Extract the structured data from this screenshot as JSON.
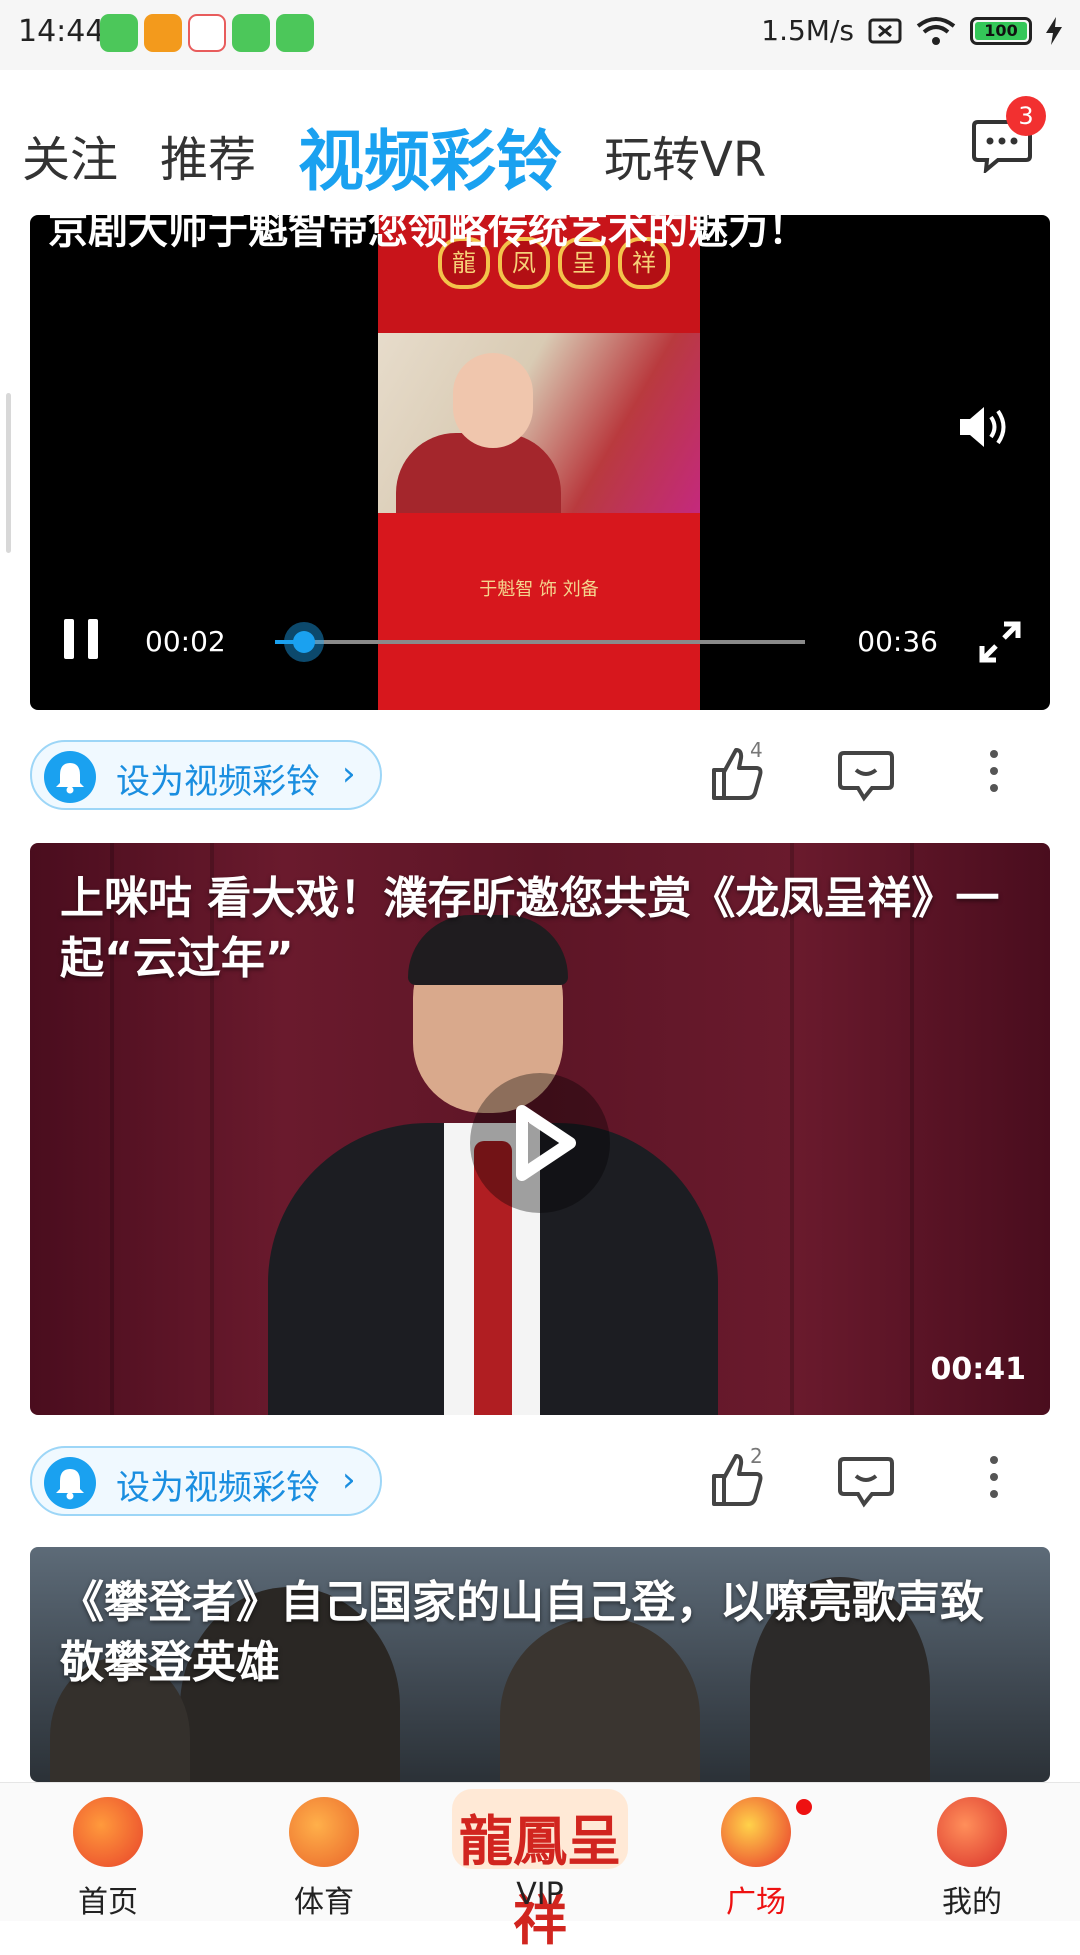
{
  "status_bar": {
    "time": "14:44",
    "network_speed": "1.5M/s",
    "battery": "100",
    "app_icon_colors": [
      "#4cc75a",
      "#f39a1c",
      "#e85c5c",
      "#4cc75a",
      "#4cc75a"
    ]
  },
  "top_tabs": {
    "items": [
      "关注",
      "推荐",
      "视频彩铃",
      "玩转VR"
    ],
    "active_index": 2,
    "message_badge": "3"
  },
  "video1": {
    "title_partial": "京剧大师于魁智带您领略传统艺术的魅力！",
    "poster_circles": [
      "龍",
      "凤",
      "呈",
      "祥"
    ],
    "poster_caption": "于魁智 饰 刘备",
    "current_time": "00:02",
    "total_time": "00:36",
    "progress": 0.055
  },
  "actions1": {
    "ring_label": "设为视频彩铃",
    "chevron": "›",
    "like_count": "4"
  },
  "video2": {
    "title": "上咪咕 看大戏！濮存昕邀您共赏《龙凤呈祥》一起“云过年”",
    "duration": "00:41"
  },
  "actions2": {
    "ring_label": "设为视频彩铃",
    "chevron": "›",
    "like_count": "2"
  },
  "video3": {
    "title": "《攀登者》自己国家的山自己登，以嘹亮歌声致敬攀登英雄"
  },
  "bottom_nav": {
    "items": [
      {
        "label": "首页",
        "icon": "home-fortune-bag-icon"
      },
      {
        "label": "体育",
        "icon": "sports-mascot-icon"
      },
      {
        "label": "VIP",
        "icon": "vip-longfengchengxiang-logo",
        "logo_text": "龍鳳呈祥"
      },
      {
        "label": "广场",
        "icon": "plaza-firecracker-icon"
      },
      {
        "label": "我的",
        "icon": "profile-ox-mascot-icon"
      }
    ],
    "active_index": 3
  },
  "colors": {
    "accent": "#1aa1f0",
    "active_nav": "#ee1111",
    "badge": "#f23030"
  }
}
